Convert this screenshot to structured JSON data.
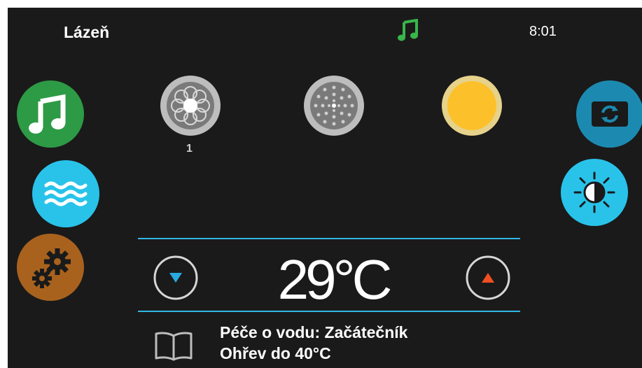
{
  "status_bar": {
    "title": "Lázeň",
    "time": "8:01",
    "music_indicator_icon": "music-note-icon"
  },
  "left_buttons": [
    {
      "name": "music",
      "icon": "music-note-icon",
      "color": "#2d9a45"
    },
    {
      "name": "water",
      "icon": "waves-icon",
      "color": "#29c3ea"
    },
    {
      "name": "settings",
      "icon": "gears-icon",
      "color": "#a8621e"
    }
  ],
  "right_buttons": [
    {
      "name": "source",
      "icon": "refresh-screen-icon",
      "color": "#1c8ab0"
    },
    {
      "name": "light",
      "icon": "brightness-icon",
      "color": "#29c3ea"
    }
  ],
  "jets": [
    {
      "name": "jet-1",
      "label": "1",
      "icon": "jet-flower-icon"
    },
    {
      "name": "jet-2",
      "label": "",
      "icon": "jet-dots-icon"
    },
    {
      "name": "jet-3",
      "label": "",
      "icon": "yellow-light-icon",
      "color": "#fcc12a"
    }
  ],
  "temperature": {
    "value": "29°C",
    "down_icon": "triangle-down-icon",
    "up_icon": "triangle-up-icon"
  },
  "info": {
    "line1": "Péče o vodu: Začátečník",
    "line2": "Ohřev do 40°C",
    "icon": "book-icon"
  },
  "colors": {
    "accent": "#2fb8e6",
    "background": "#1a1a1a",
    "up_arrow": "#f04e23",
    "down_arrow": "#29a8e0"
  }
}
